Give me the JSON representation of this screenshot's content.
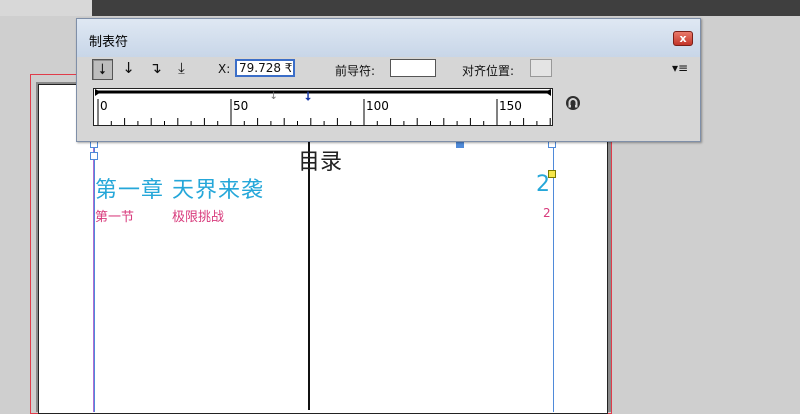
{
  "panel": {
    "title": "制表符",
    "close_label": "x",
    "x_label": "X:",
    "x_value": "79.728 ₹",
    "leader_label": "前导符:",
    "leader_value": "",
    "align_label": "对齐位置:",
    "align_value": "",
    "tab_types": [
      {
        "name": "left-justified-tab",
        "glyph": "⭣",
        "active": true
      },
      {
        "name": "center-justified-tab",
        "glyph": "↓",
        "active": false
      },
      {
        "name": "right-justified-tab",
        "glyph": "↴",
        "active": false
      },
      {
        "name": "align-to-decimal-tab",
        "glyph": "⤓",
        "active": false
      }
    ],
    "ruler": {
      "min": 0,
      "max": 170,
      "labels": [
        "0",
        "50",
        "100",
        "150"
      ],
      "tab_stop": 79.728,
      "ghost_stop": 66
    },
    "icons": {
      "menu": "panel-menu-icon",
      "magnet": "position-panel-above-frame-icon"
    }
  },
  "document": {
    "toc_title": "目录",
    "chapter": "第一章 天界来袭",
    "chapter_page": "2",
    "section_label": "第一节",
    "section_title": "极限挑战",
    "section_page": "2"
  },
  "colors": {
    "chapter": "#25a7d9",
    "section": "#d83b7c",
    "frame": "#4f8ad9",
    "bleed": "#e03c4a",
    "margin": "#b06cd1"
  }
}
